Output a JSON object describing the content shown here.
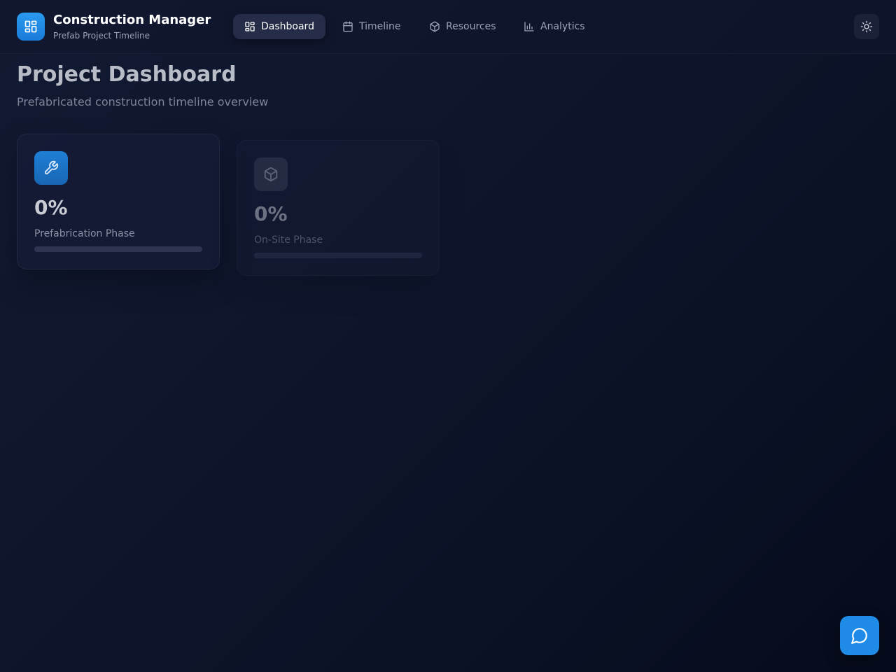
{
  "header": {
    "title": "Construction Manager",
    "subtitle": "Prefab Project Timeline",
    "logo_icon": "grid-icon",
    "nav": [
      {
        "label": "Dashboard",
        "icon": "grid-icon",
        "active": true
      },
      {
        "label": "Timeline",
        "icon": "calendar-icon",
        "active": false
      },
      {
        "label": "Resources",
        "icon": "box-icon",
        "active": false
      },
      {
        "label": "Analytics",
        "icon": "bar-chart-icon",
        "active": false
      }
    ],
    "theme_toggle_icon": "sun-icon"
  },
  "main": {
    "title": "Project Dashboard",
    "subtitle": "Prefabricated construction timeline overview",
    "cards": [
      {
        "value": "0%",
        "label": "Prefabrication Phase",
        "icon": "wrench-icon",
        "progress": 0
      },
      {
        "value": "0%",
        "label": "On-Site Phase",
        "icon": "box-icon",
        "progress": 0
      }
    ]
  },
  "chat_button_icon": "chat-bubble-icon",
  "colors": {
    "accent": "#1f8be6",
    "background": "#0e152b",
    "active_nav_bg": "#242c48"
  }
}
